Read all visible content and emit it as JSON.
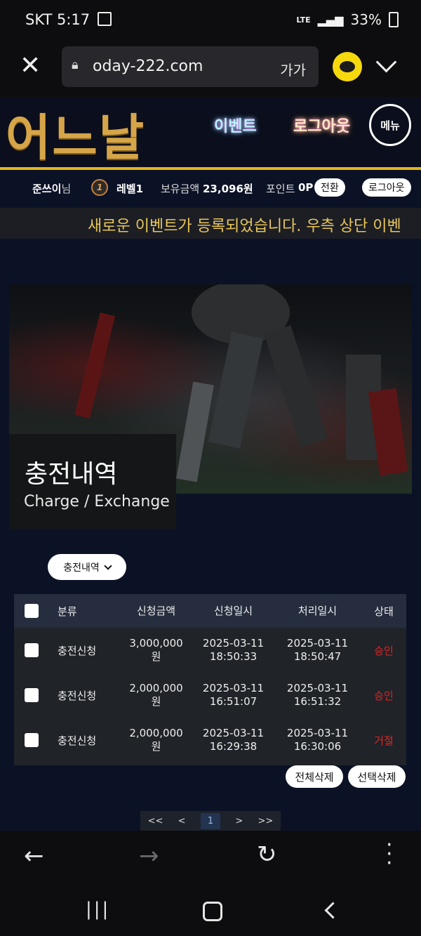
{
  "status": {
    "carrier": "SKT",
    "time": "5:17",
    "network": "LTE",
    "battery": "33%"
  },
  "browser": {
    "url": "oday-222.com",
    "text_size": "가가"
  },
  "site": {
    "logo": "어느날",
    "nav_event": "이벤트",
    "nav_logout": "로그아웃",
    "menu": "메뉴"
  },
  "user": {
    "name": "준쓰이",
    "suffix": "님",
    "level_badge": "1",
    "level": "레벨1",
    "balance_label": "보유금액",
    "balance": "23,096원",
    "points_label": "포인트",
    "points": "0P",
    "convert": "전환",
    "logout": "로그아웃"
  },
  "notice": "새로운 이벤트가 등록되었습니다. 우측 상단 이벤",
  "page": {
    "title": "충전내역",
    "subtitle": "Charge / Exchange",
    "filter": "충전내역"
  },
  "table": {
    "headers": [
      "분류",
      "신청금액",
      "신청일시",
      "처리일시",
      "상태"
    ],
    "rows": [
      {
        "type": "충전신청",
        "amount": "3,000,000",
        "unit": "원",
        "req_date": "2025-03-11",
        "req_time": "18:50:33",
        "proc_date": "2025-03-11",
        "proc_time": "18:50:47",
        "status": "승인"
      },
      {
        "type": "충전신청",
        "amount": "2,000,000",
        "unit": "원",
        "req_date": "2025-03-11",
        "req_time": "16:51:07",
        "proc_date": "2025-03-11",
        "proc_time": "16:51:32",
        "status": "승인"
      },
      {
        "type": "충전신청",
        "amount": "2,000,000",
        "unit": "원",
        "req_date": "2025-03-11",
        "req_time": "16:29:38",
        "proc_date": "2025-03-11",
        "proc_time": "16:30:06",
        "status": "거절"
      }
    ],
    "delete_all": "전체삭제",
    "delete_selected": "선택삭제"
  },
  "pager": {
    "first": "<<",
    "prev": "<",
    "current": "1",
    "next": ">",
    "last": ">>"
  },
  "colors": {
    "accent_gold": "#e3b51b",
    "status_red": "#e02424",
    "background": "#0c1226"
  }
}
